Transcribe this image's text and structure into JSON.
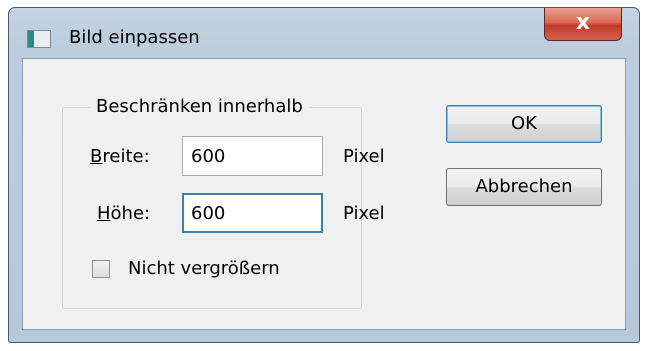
{
  "window": {
    "title": "Bild einpassen",
    "close_symbol": "x",
    "icon": "app-window-icon"
  },
  "group": {
    "legend": "Beschränken innerhalb"
  },
  "width": {
    "label_mnemonic": "B",
    "label_rest": "reite:",
    "value": "600",
    "unit": "Pixel"
  },
  "height": {
    "label_mnemonic": "H",
    "label_rest": "öhe:",
    "value": "600",
    "unit": "Pixel"
  },
  "checkbox": {
    "label": "Nicht vergrößern",
    "checked": false
  },
  "buttons": {
    "ok": "OK",
    "cancel": "Abbrechen"
  },
  "colors": {
    "focus_border": "#3c7fb1",
    "close_button": "#c0392b"
  }
}
